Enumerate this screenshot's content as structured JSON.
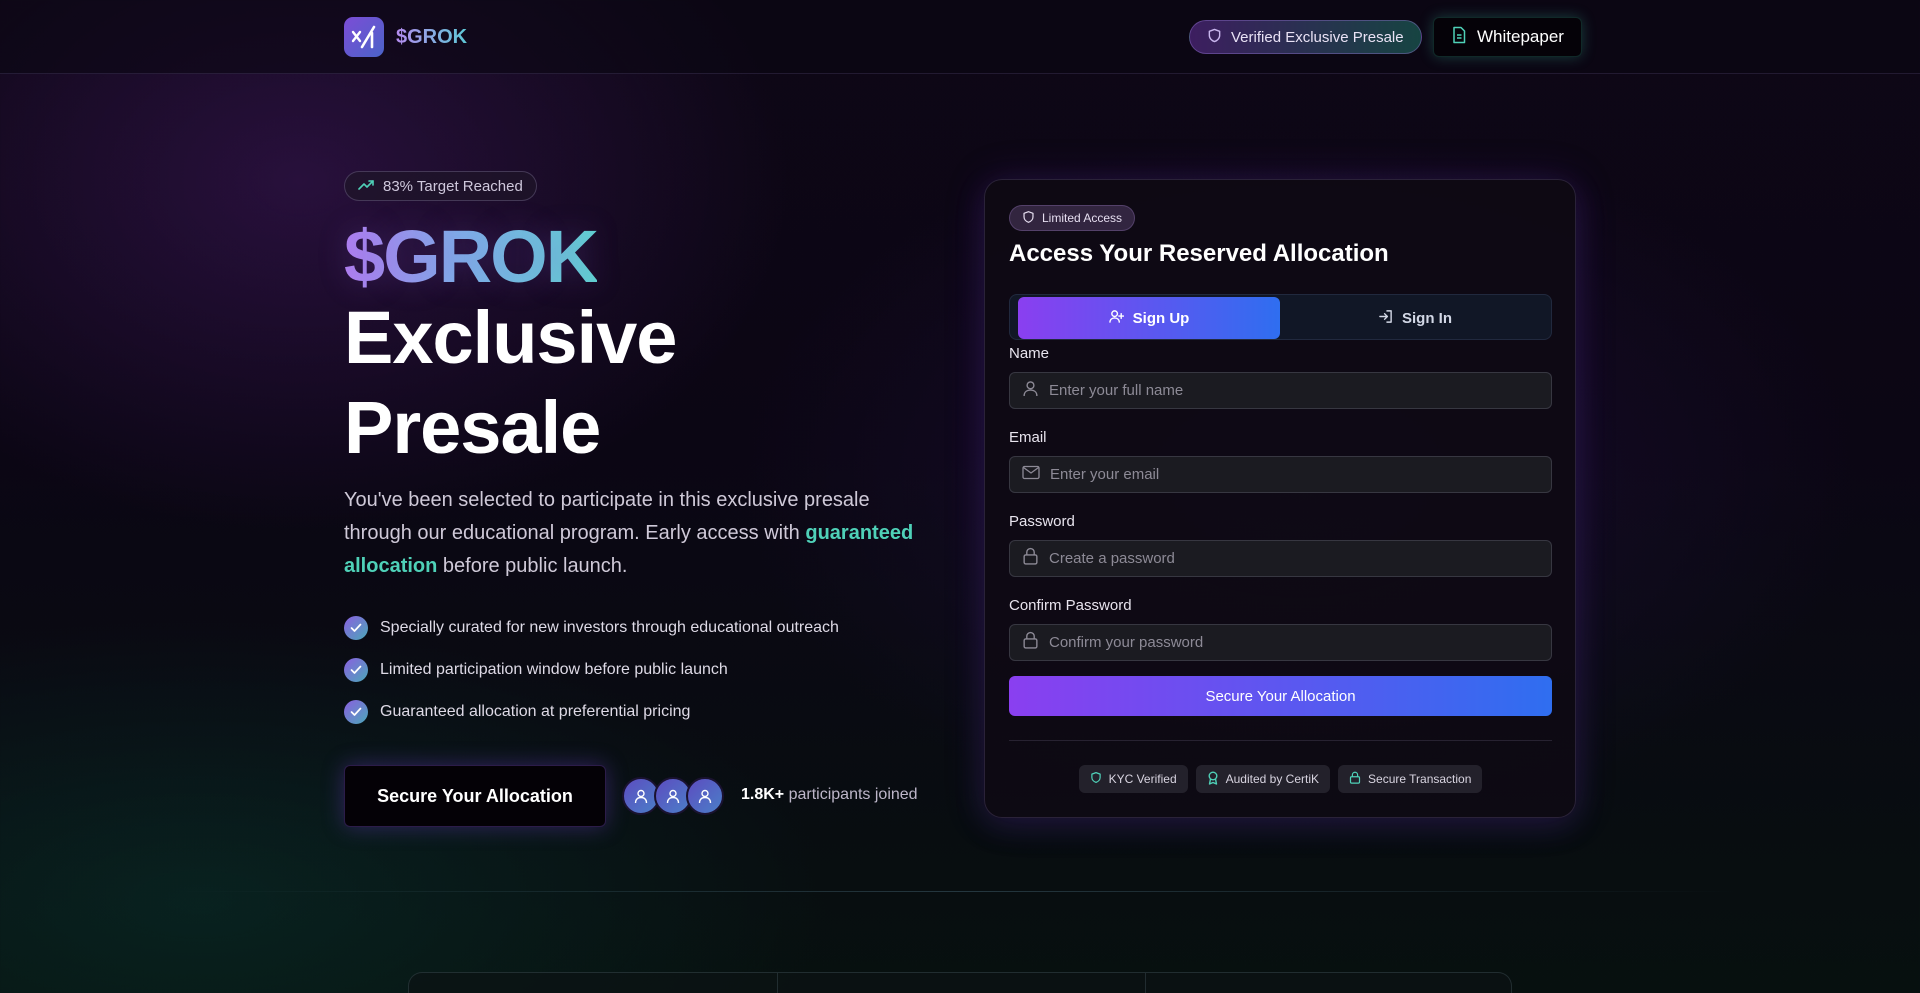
{
  "header": {
    "logo_text": "$GROK",
    "verified_label": "Verified Exclusive Presale",
    "whitepaper_label": "Whitepaper"
  },
  "hero": {
    "target_pill": "83% Target Reached",
    "title_token": "$GROK",
    "title_line1": "Exclusive",
    "title_line2": "Presale",
    "desc_part1": "You've been selected to participate in this exclusive presale through our educational program. Early access with ",
    "desc_highlight": "guaranteed allocation",
    "desc_part2": " before public launch.",
    "features": [
      "Specially curated for new investors through educational outreach",
      "Limited participation window before public launch",
      "Guaranteed allocation at preferential pricing"
    ],
    "cta_label": "Secure Your Allocation",
    "participants_count": "1.8K+",
    "participants_text": "participants joined"
  },
  "form": {
    "badge": "Limited Access",
    "title": "Access Your Reserved Allocation",
    "tabs": [
      {
        "label": "Sign Up",
        "active": true
      },
      {
        "label": "Sign In",
        "active": false
      }
    ],
    "fields": [
      {
        "label": "Name",
        "placeholder": "Enter your full name",
        "value": "",
        "icon": "user-icon"
      },
      {
        "label": "Email",
        "placeholder": "Enter your email",
        "value": "",
        "icon": "mail-icon"
      },
      {
        "label": "Password",
        "placeholder": "Create a password",
        "value": "",
        "icon": "lock-icon"
      },
      {
        "label": "Confirm Password",
        "placeholder": "Confirm your password",
        "value": "",
        "icon": "lock-icon"
      }
    ],
    "submit_label": "Secure Your Allocation",
    "trust_badges": [
      "KYC Verified",
      "Audited by CertiK",
      "Secure Transaction"
    ]
  },
  "colors": {
    "accent_purple": "#8a3ff0",
    "accent_blue": "#2f6ef0",
    "accent_teal": "#4fd1b8"
  }
}
